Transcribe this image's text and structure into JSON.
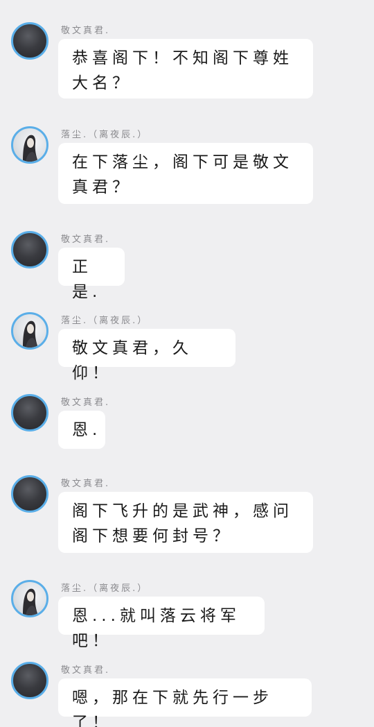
{
  "messages": [
    {
      "sender": "敬文真君.",
      "avatar": "dark-avatar",
      "text": "恭喜阁下！不知阁下尊姓大名？"
    },
    {
      "sender": "落尘.（离夜辰.）",
      "avatar": "girl-avatar",
      "text": "在下落尘，阁下可是敬文真君？"
    },
    {
      "sender": "敬文真君.",
      "avatar": "dark-avatar",
      "text": "正是."
    },
    {
      "sender": "落尘.（离夜辰.）",
      "avatar": "girl-avatar",
      "text": "敬文真君，久仰！"
    },
    {
      "sender": "敬文真君.",
      "avatar": "dark-avatar",
      "text": "恩."
    },
    {
      "sender": "敬文真君.",
      "avatar": "dark-avatar",
      "text": "阁下飞升的是武神，感问阁下想要何封号？"
    },
    {
      "sender": "落尘.（离夜辰.）",
      "avatar": "girl-avatar",
      "text": "恩...就叫落云将军吧！"
    },
    {
      "sender": "敬文真君.",
      "avatar": "dark-avatar",
      "text": "嗯，那在下就先行一步了！"
    }
  ],
  "colors": {
    "background": "#efeff1",
    "bubble": "#ffffff",
    "avatar_ring": "#5aaee8",
    "sender_text": "#8a8a8e",
    "message_text": "#1a1a1a"
  }
}
